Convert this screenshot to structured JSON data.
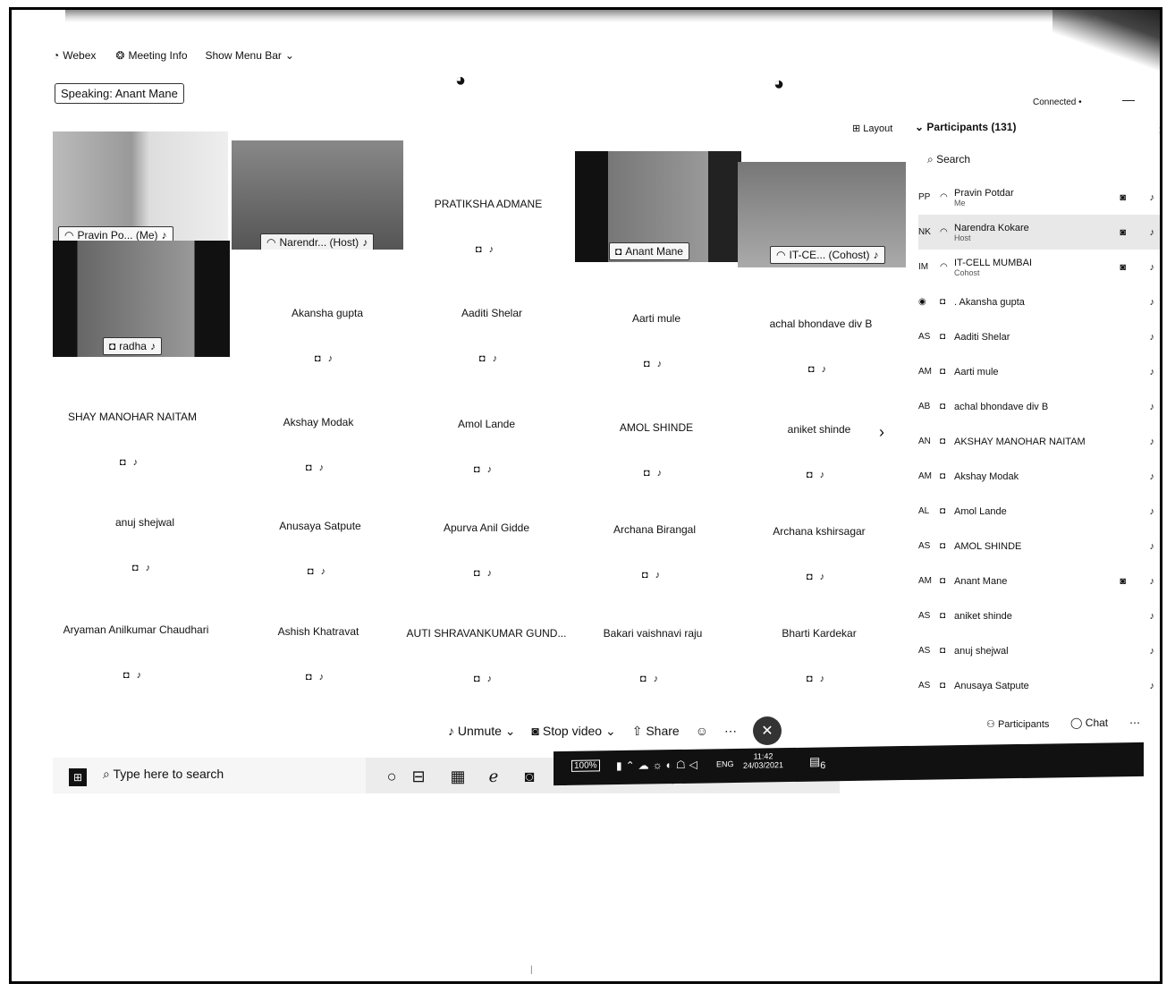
{
  "menu": {
    "webex": "Webex",
    "meeting_info": "Meeting Info",
    "show_menu_bar": "Show Menu Bar"
  },
  "speaking": "Speaking: Anant Mane",
  "connected": "Connected",
  "layout": "Layout",
  "videos": {
    "pravin": "Pravin Po... (Me)",
    "narendra": "Narendr... (Host)",
    "radha": "radha",
    "anant": "Anant Mane",
    "itcell": "IT-CE... (Cohost)"
  },
  "tiles": {
    "pratiksha": "PRATIKSHA ADMANE",
    "r1": [
      "Akansha gupta",
      "Aaditi Shelar",
      "Aarti mule",
      "achal bhondave div B"
    ],
    "r2": [
      "SHAY MANOHAR NAITAM",
      "Akshay Modak",
      "Amol Lande",
      "AMOL SHINDE",
      "aniket shinde"
    ],
    "r3": [
      "anuj shejwal",
      "Anusaya Satpute",
      "Apurva Anil Gidde",
      "Archana Birangal",
      "Archana kshirsagar"
    ],
    "r4": [
      "Aryaman Anilkumar Chaudhari",
      "Ashish Khatravat",
      "AUTI SHRAVANKUMAR GUND...",
      "Bakari vaishnavi raju",
      "Bharti Kardekar"
    ]
  },
  "participants": {
    "title": "Participants (131)",
    "search": "Search",
    "list": [
      {
        "initials": "PP",
        "name": "Pravin Potdar",
        "sub": "Me"
      },
      {
        "initials": "NK",
        "name": "Narendra Kokare",
        "sub": "Host"
      },
      {
        "initials": "IM",
        "name": "IT-CELL MUMBAI",
        "sub": "Cohost"
      },
      {
        "initials": "",
        "name": ". Akansha gupta",
        "sub": ""
      },
      {
        "initials": "AS",
        "name": "Aaditi Shelar",
        "sub": ""
      },
      {
        "initials": "AM",
        "name": "Aarti mule",
        "sub": ""
      },
      {
        "initials": "AB",
        "name": "achal bhondave div B",
        "sub": ""
      },
      {
        "initials": "AN",
        "name": "AKSHAY MANOHAR NAITAM",
        "sub": ""
      },
      {
        "initials": "AM",
        "name": "Akshay Modak",
        "sub": ""
      },
      {
        "initials": "AL",
        "name": "Amol Lande",
        "sub": ""
      },
      {
        "initials": "AS",
        "name": "AMOL SHINDE",
        "sub": ""
      },
      {
        "initials": "AM",
        "name": "Anant Mane",
        "sub": ""
      },
      {
        "initials": "AS",
        "name": "aniket shinde",
        "sub": ""
      },
      {
        "initials": "AS",
        "name": "anuj shejwal",
        "sub": ""
      },
      {
        "initials": "AS",
        "name": "Anusaya Satpute",
        "sub": ""
      }
    ]
  },
  "controls": {
    "unmute": "Unmute",
    "stop_video": "Stop video",
    "share": "Share",
    "participants": "Participants",
    "chat": "Chat"
  },
  "taskbar": {
    "search": "Type here to search",
    "battery": "100%",
    "lang": "ENG",
    "time": "11:42",
    "date": "24/03/2021",
    "notif": "6"
  }
}
